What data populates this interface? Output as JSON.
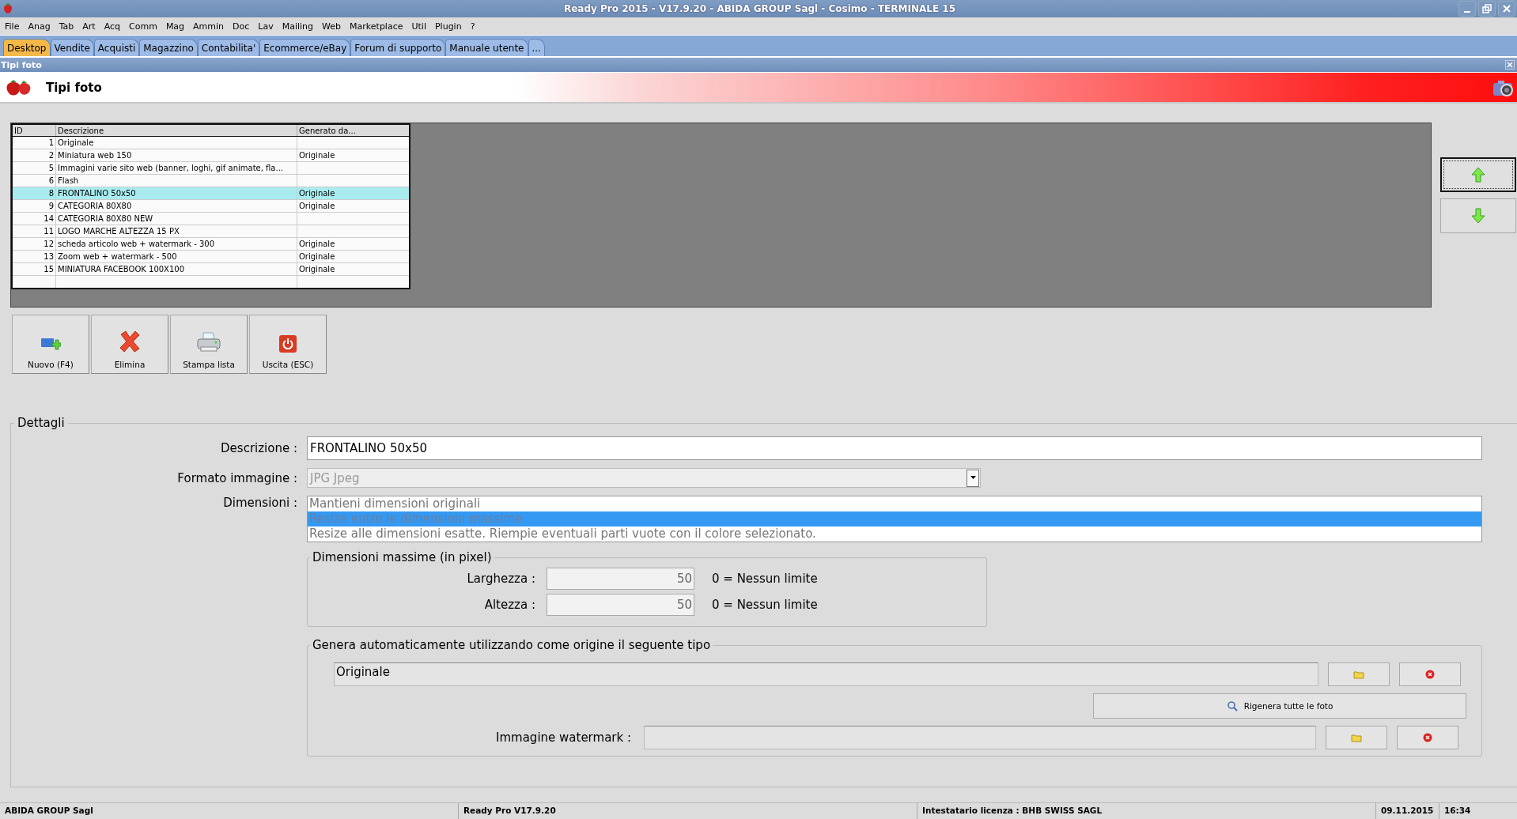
{
  "window": {
    "title": "Ready Pro 2015 - V17.9.20 - ABIDA GROUP Sagl - Cosimo - TERMINALE 15"
  },
  "menu": [
    "File",
    "Anag",
    "Tab",
    "Art",
    "Acq",
    "Comm",
    "Mag",
    "Ammin",
    "Doc",
    "Lav",
    "Mailing",
    "Web",
    "Marketplace",
    "Util",
    "Plugin",
    "?"
  ],
  "tabs": [
    {
      "label": "Desktop",
      "selected": true
    },
    {
      "label": "Vendite",
      "selected": false
    },
    {
      "label": "Acquisti",
      "selected": false
    },
    {
      "label": "Magazzino",
      "selected": false
    },
    {
      "label": "Contabilita'",
      "selected": false
    },
    {
      "label": "Ecommerce/eBay",
      "selected": false
    },
    {
      "label": "Forum di supporto",
      "selected": false
    },
    {
      "label": "Manuale utente",
      "selected": false
    },
    {
      "label": "...",
      "selected": false
    }
  ],
  "subwindow": {
    "title": "Tipi foto",
    "header": "Tipi foto"
  },
  "table": {
    "columns": [
      "ID",
      "Descrizione",
      "Generato da..."
    ],
    "rows": [
      {
        "id": "1",
        "descrizione": "Originale",
        "generato": "",
        "selected": false
      },
      {
        "id": "2",
        "descrizione": "Miniatura web 150",
        "generato": "Originale",
        "selected": false
      },
      {
        "id": "5",
        "descrizione": "Immagini varie sito web (banner, loghi, gif animate, fla...",
        "generato": "",
        "selected": false
      },
      {
        "id": "6",
        "descrizione": "Flash",
        "generato": "",
        "selected": false
      },
      {
        "id": "8",
        "descrizione": "FRONTALINO 50x50",
        "generato": "Originale",
        "selected": true
      },
      {
        "id": "9",
        "descrizione": "CATEGORIA 80X80",
        "generato": "Originale",
        "selected": false
      },
      {
        "id": "14",
        "descrizione": "CATEGORIA 80X80 NEW",
        "generato": "",
        "selected": false
      },
      {
        "id": "11",
        "descrizione": "LOGO MARCHE ALTEZZA 15 PX",
        "generato": "",
        "selected": false
      },
      {
        "id": "12",
        "descrizione": "scheda articolo web + watermark - 300",
        "generato": "Originale",
        "selected": false
      },
      {
        "id": "13",
        "descrizione": "Zoom web + watermark - 500",
        "generato": "Originale",
        "selected": false
      },
      {
        "id": "15",
        "descrizione": "MINIATURA FACEBOOK 100X100",
        "generato": "Originale",
        "selected": false
      }
    ]
  },
  "toolbar": [
    {
      "kind": "new",
      "label": "Nuovo (F4)"
    },
    {
      "kind": "delete",
      "label": "Elimina"
    },
    {
      "kind": "print",
      "label": "Stampa lista"
    },
    {
      "kind": "exit",
      "label": "Uscita (ESC)"
    }
  ],
  "details": {
    "title": "Dettagli",
    "descrizione": {
      "label": "Descrizione :",
      "value": "FRONTALINO 50x50"
    },
    "formato": {
      "label": "Formato immagine :",
      "value": "JPG Jpeg",
      "disabled": true
    },
    "dimensioni": {
      "label": "Dimensioni :",
      "options": [
        {
          "label": "Mantieni dimensioni originali",
          "selected": false
        },
        {
          "label": "Resize entro le dimensioni massime",
          "selected": true
        },
        {
          "label": "Resize alle dimensioni esatte. Riempie eventuali parti vuote con il colore selezionato.",
          "selected": false
        }
      ]
    },
    "massime": {
      "title": "Dimensioni massime (in pixel)",
      "fields": [
        {
          "label": "Larghezza :",
          "value": "50",
          "hint": "0 =  Nessun limite"
        },
        {
          "label": "Altezza :",
          "value": "50",
          "hint": "0 =  Nessun limite"
        }
      ]
    },
    "genera": {
      "title": "Genera automaticamente utilizzando come origine il seguente tipo",
      "origine": "Originale",
      "rigenera": "Rigenera tutte le foto",
      "watermark_label": "Immagine watermark :"
    }
  },
  "status_bar": [
    "ABIDA GROUP Sagl",
    "Ready Pro V17.9.20",
    "Intestatario licenza : BHB SWISS SAGL",
    "09.11.2015",
    "16:34"
  ]
}
